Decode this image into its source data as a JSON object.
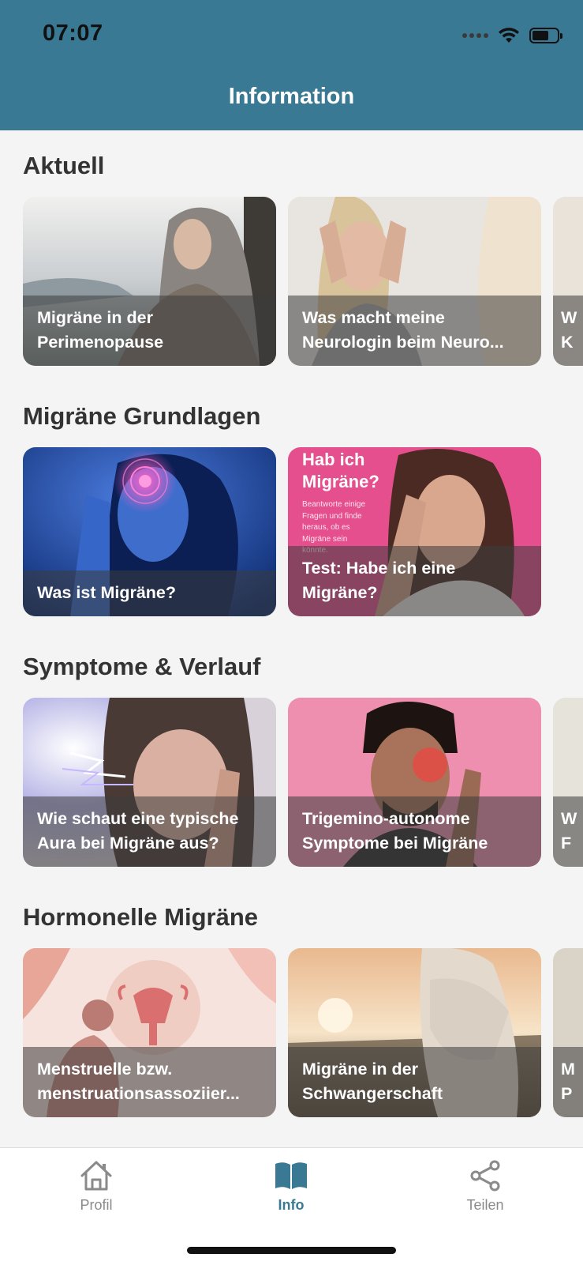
{
  "status_bar": {
    "time": "07:07"
  },
  "header": {
    "title": "Information"
  },
  "colors": {
    "accent": "#397994",
    "overlay": "rgba(60,60,60,0.55)"
  },
  "sections": [
    {
      "title": "Aktuell",
      "cards": [
        {
          "title": "Migräne in der\nPerimenopause",
          "image": "woman-relaxing-outdoors"
        },
        {
          "title": "Was macht meine\nNeurologin beim Neuro...",
          "image": "woman-holding-head"
        },
        {
          "title": "W\nK",
          "image": "partial-card"
        }
      ]
    },
    {
      "title": "Migräne Grundlagen",
      "cards": [
        {
          "title": "Was ist Migräne?",
          "image": "blue-migraine-illustration"
        },
        {
          "title": "Test: Habe ich eine\nMigräne?",
          "image": "pink-quiz-woman",
          "image_text": {
            "heading": "Hab ich\nMigräne?",
            "body": "Beantworte einige\nFragen und finde\nheraus, ob es\nMigräne sein\nkönnte."
          }
        }
      ]
    },
    {
      "title": "Symptome & Verlauf",
      "cards": [
        {
          "title": "Wie schaut eine typische\nAura bei Migräne aus?",
          "image": "aura-woman"
        },
        {
          "title": "Trigemino-autonome\nSymptome bei Migräne",
          "image": "man-eye-pain"
        },
        {
          "title": "W\nF",
          "image": "partial-card"
        }
      ]
    },
    {
      "title": "Hormonelle Migräne",
      "cards": [
        {
          "title": "Menstruelle bzw.\nmenstruationsassoziier...",
          "image": "uterus-illustration"
        },
        {
          "title": "Migräne in der\nSchwangerschaft",
          "image": "pregnant-woman-sunset"
        },
        {
          "title": "M\nP",
          "image": "partial-card"
        }
      ]
    }
  ],
  "bottom_nav": [
    {
      "label": "Profil",
      "icon": "home-icon",
      "active": false
    },
    {
      "label": "Info",
      "icon": "book-icon",
      "active": true
    },
    {
      "label": "Teilen",
      "icon": "share-icon",
      "active": false
    }
  ]
}
